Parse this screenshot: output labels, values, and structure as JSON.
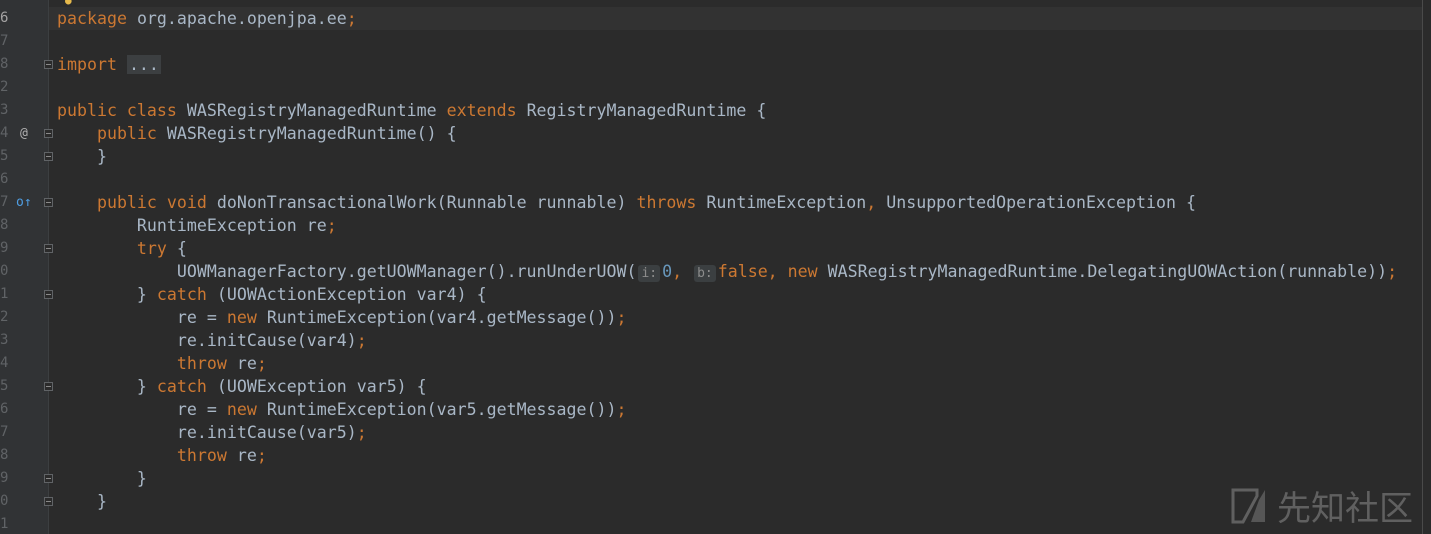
{
  "editor": {
    "lines": [
      {
        "num": "6",
        "current": true,
        "fold": false,
        "icon": "",
        "tokens": [
          {
            "t": "package ",
            "c": "kw"
          },
          {
            "t": "org.apache.openjpa.ee",
            "c": "plain"
          },
          {
            "t": ";",
            "c": "kw"
          }
        ]
      },
      {
        "num": "7",
        "fold": false,
        "icon": "",
        "tokens": []
      },
      {
        "num": "8",
        "fold": true,
        "icon": "",
        "tokens": [
          {
            "t": "import ",
            "c": "kw"
          },
          {
            "t": "...",
            "c": "fold-ph"
          }
        ]
      },
      {
        "num": "2",
        "fold": false,
        "icon": "",
        "tokens": []
      },
      {
        "num": "3",
        "fold": false,
        "icon": "",
        "tokens": [
          {
            "t": "public class ",
            "c": "kw"
          },
          {
            "t": "WASRegistryManagedRuntime ",
            "c": "plain"
          },
          {
            "t": "extends ",
            "c": "kw"
          },
          {
            "t": "RegistryManagedRuntime {",
            "c": "plain"
          }
        ]
      },
      {
        "num": "4",
        "fold": true,
        "icon": "@",
        "tokens": [
          {
            "t": "    public ",
            "c": "kw"
          },
          {
            "t": "WASRegistryManagedRuntime() {",
            "c": "plain"
          }
        ]
      },
      {
        "num": "5",
        "fold": true,
        "icon": "",
        "tokens": [
          {
            "t": "    }",
            "c": "plain"
          }
        ]
      },
      {
        "num": "6",
        "fold": false,
        "icon": "",
        "tokens": []
      },
      {
        "num": "7",
        "fold": true,
        "icon": "o↑",
        "tokens": [
          {
            "t": "    public void ",
            "c": "kw"
          },
          {
            "t": "doNonTransactionalWork(Runnable runnable) ",
            "c": "plain"
          },
          {
            "t": "throws ",
            "c": "kw"
          },
          {
            "t": "RuntimeException",
            "c": "plain"
          },
          {
            "t": ", ",
            "c": "kw"
          },
          {
            "t": "UnsupportedOperationException {",
            "c": "plain"
          }
        ]
      },
      {
        "num": "8",
        "fold": false,
        "icon": "",
        "tokens": [
          {
            "t": "        RuntimeException re",
            "c": "plain"
          },
          {
            "t": ";",
            "c": "kw"
          }
        ]
      },
      {
        "num": "9",
        "fold": true,
        "icon": "",
        "tokens": [
          {
            "t": "        try ",
            "c": "kw"
          },
          {
            "t": "{",
            "c": "plain"
          }
        ]
      },
      {
        "num": "0",
        "fold": false,
        "icon": "",
        "tokens": [
          {
            "t": "            UOWManagerFactory.getUOWManager().runUnderUOW(",
            "c": "plain"
          },
          {
            "t": "i:",
            "c": "hint"
          },
          {
            "t": "0",
            "c": "num"
          },
          {
            "t": ", ",
            "c": "kw"
          },
          {
            "t": "b:",
            "c": "hint"
          },
          {
            "t": "false, new ",
            "c": "kw"
          },
          {
            "t": "WASRegistryManagedRuntime.DelegatingUOWAction(runnable))",
            "c": "plain"
          },
          {
            "t": ";",
            "c": "kw"
          }
        ]
      },
      {
        "num": "1",
        "fold": true,
        "icon": "",
        "tokens": [
          {
            "t": "        } ",
            "c": "plain"
          },
          {
            "t": "catch ",
            "c": "kw"
          },
          {
            "t": "(UOWActionException var4) {",
            "c": "plain"
          }
        ]
      },
      {
        "num": "2",
        "fold": false,
        "icon": "",
        "tokens": [
          {
            "t": "            re = ",
            "c": "plain"
          },
          {
            "t": "new ",
            "c": "kw"
          },
          {
            "t": "RuntimeException(var4.getMessage())",
            "c": "plain"
          },
          {
            "t": ";",
            "c": "kw"
          }
        ]
      },
      {
        "num": "3",
        "fold": false,
        "icon": "",
        "tokens": [
          {
            "t": "            re.initCause(var4)",
            "c": "plain"
          },
          {
            "t": ";",
            "c": "kw"
          }
        ]
      },
      {
        "num": "4",
        "fold": false,
        "icon": "",
        "tokens": [
          {
            "t": "            throw ",
            "c": "kw"
          },
          {
            "t": "re",
            "c": "plain"
          },
          {
            "t": ";",
            "c": "kw"
          }
        ]
      },
      {
        "num": "5",
        "fold": true,
        "icon": "",
        "tokens": [
          {
            "t": "        } ",
            "c": "plain"
          },
          {
            "t": "catch ",
            "c": "kw"
          },
          {
            "t": "(UOWException var5) {",
            "c": "plain"
          }
        ]
      },
      {
        "num": "6",
        "fold": false,
        "icon": "",
        "tokens": [
          {
            "t": "            re = ",
            "c": "plain"
          },
          {
            "t": "new ",
            "c": "kw"
          },
          {
            "t": "RuntimeException(var5.getMessage())",
            "c": "plain"
          },
          {
            "t": ";",
            "c": "kw"
          }
        ]
      },
      {
        "num": "7",
        "fold": false,
        "icon": "",
        "tokens": [
          {
            "t": "            re.initCause(var5)",
            "c": "plain"
          },
          {
            "t": ";",
            "c": "kw"
          }
        ]
      },
      {
        "num": "8",
        "fold": false,
        "icon": "",
        "tokens": [
          {
            "t": "            throw ",
            "c": "kw"
          },
          {
            "t": "re",
            "c": "plain"
          },
          {
            "t": ";",
            "c": "kw"
          }
        ]
      },
      {
        "num": "9",
        "fold": true,
        "icon": "",
        "tokens": [
          {
            "t": "        }",
            "c": "plain"
          }
        ]
      },
      {
        "num": "0",
        "fold": true,
        "icon": "",
        "tokens": [
          {
            "t": "    }",
            "c": "plain"
          }
        ]
      },
      {
        "num": "1",
        "fold": false,
        "icon": "",
        "tokens": []
      }
    ]
  },
  "watermark": {
    "text": "先知社区"
  },
  "colors": {
    "background": "#2b2b2b",
    "keyword": "#cc7832",
    "text": "#a9b7c6",
    "number": "#6897bb"
  }
}
